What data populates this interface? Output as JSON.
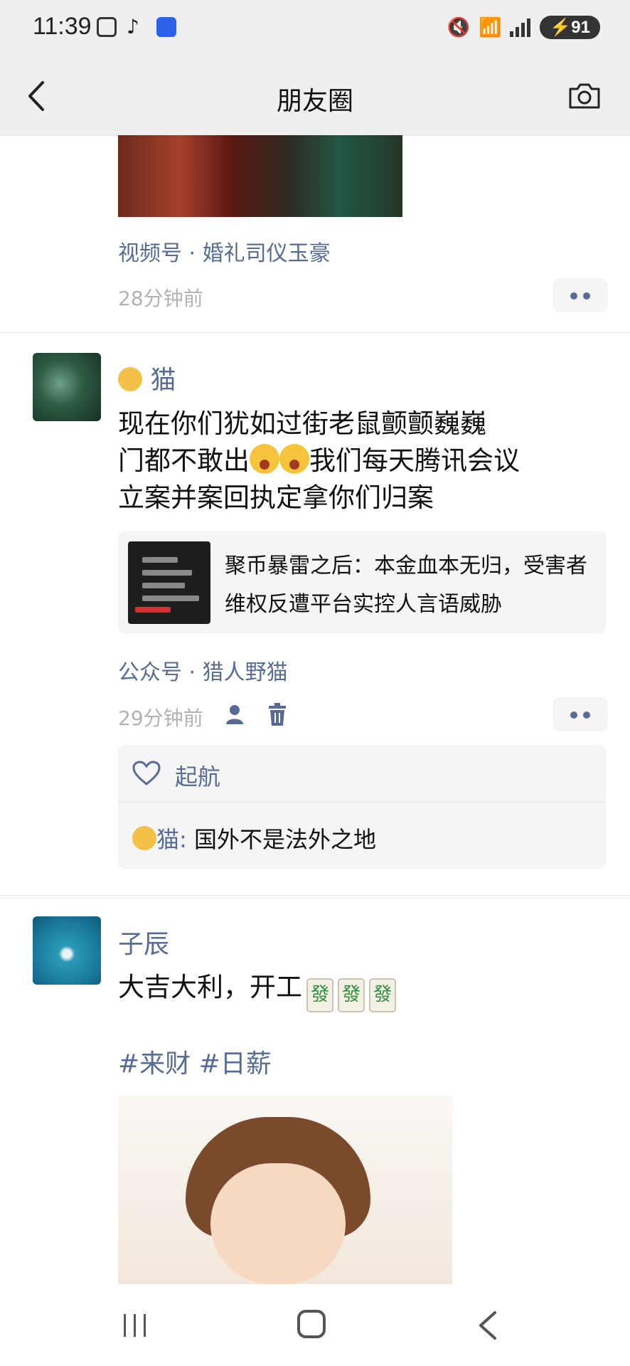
{
  "status_bar": {
    "time": "11:39",
    "battery": "91"
  },
  "header": {
    "title": "朋友圈"
  },
  "posts": [
    {
      "source": "视频号 · 婚礼司仪玉豪",
      "time": "28分钟前"
    },
    {
      "username": "猫",
      "text_lines": [
        "现在你们犹如过街老鼠颤颤巍巍",
        "门都不敢出",
        "我们每天腾讯会议",
        "立案并案回执定拿你们归案"
      ],
      "link_title": "聚币暴雷之后：本金血本无归，受害者维权反遭平台实控人言语威胁",
      "source": "公众号 · 猎人野猫",
      "time": "29分钟前",
      "likes": "起航",
      "comment": {
        "author": "猫",
        "text": "国外不是法外之地"
      }
    },
    {
      "username": "子辰",
      "text": "大吉大利，开工",
      "mahjong": [
        "發",
        "發",
        "發"
      ],
      "hashtags": "#来财 #日薪"
    }
  ]
}
